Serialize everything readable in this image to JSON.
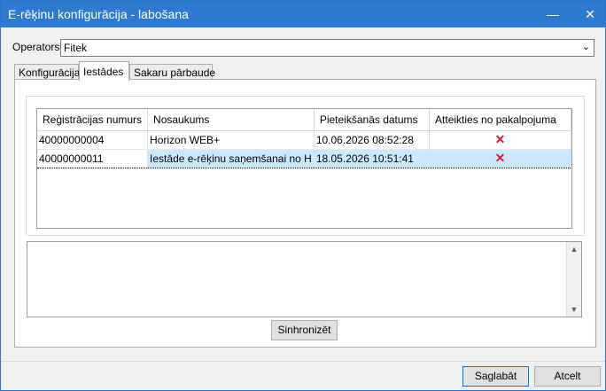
{
  "window": {
    "title": "E-rēķinu konfigurācija - labošana",
    "minimize_glyph": "—",
    "close_glyph": "✕"
  },
  "operator": {
    "label": "Operators",
    "value": "Fitek"
  },
  "tabs": [
    "Konfigurācija",
    "Iestādes",
    "Sakaru pārbaude"
  ],
  "table": {
    "columns": [
      "Reģistrācijas numurs",
      "Nosaukums",
      "Pieteikšanās datums",
      "Atteikties no pakalpojuma"
    ],
    "rows": [
      {
        "reg": "40000000004",
        "name": "Horizon WEB+",
        "date": "10.06.2026 08:52:28",
        "action": "✕"
      },
      {
        "reg": "40000000011",
        "name": "Iestāde e-rēķinu saņemšanai no H",
        "date": "18.05.2026 10:51:41",
        "action": "✕"
      }
    ]
  },
  "buttons": {
    "sync": "Sinhronizēt",
    "save": "Saglabāt",
    "cancel": "Atcelt"
  },
  "icons": {
    "scroll_up": "▲",
    "scroll_down": "▼",
    "dropdown": "⌄"
  },
  "colors": {
    "titlebar": "#2f7ad0",
    "selection": "#cce8ff",
    "delete": "#d21d2b"
  }
}
